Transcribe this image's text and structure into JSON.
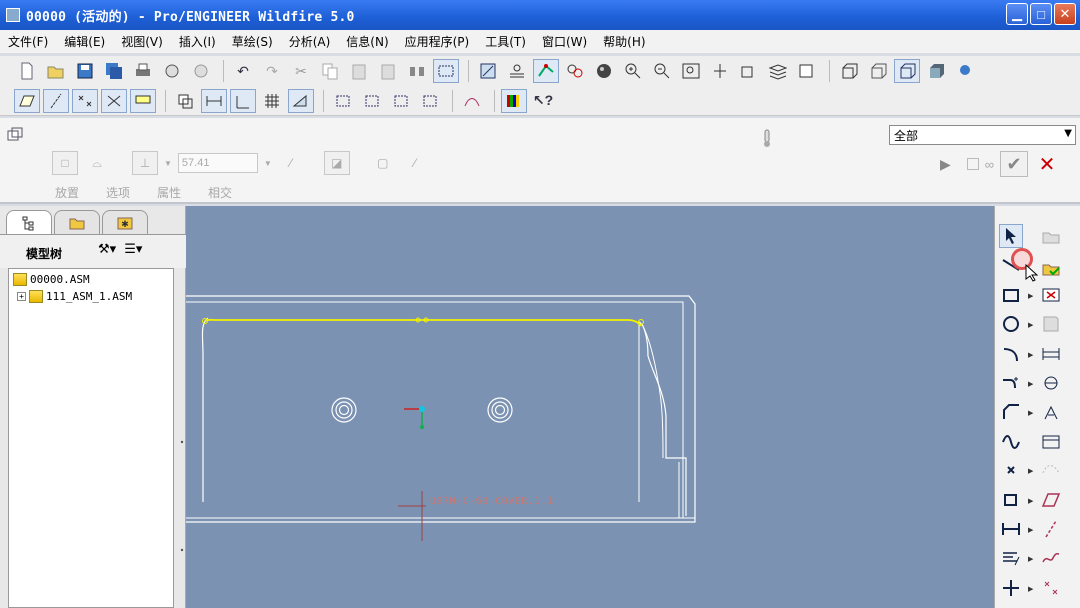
{
  "window": {
    "title": "00000 (活动的) - Pro/ENGINEER Wildfire 5.0"
  },
  "menu": [
    "文件(F)",
    "编辑(E)",
    "视图(V)",
    "插入(I)",
    "草绘(S)",
    "分析(A)",
    "信息(N)",
    "应用程序(P)",
    "工具(T)",
    "窗口(W)",
    "帮助(H)"
  ],
  "dashboard": {
    "filter_value": "全部",
    "value_field": "57.41",
    "tabs": [
      "放置",
      "选项",
      "属性",
      "相交"
    ]
  },
  "model_tree": {
    "title": "模型树",
    "items": [
      {
        "label": "00000.ASM"
      },
      {
        "label": "111_ASM_1.ASM"
      }
    ]
  },
  "canvas": {
    "annotation": "U97N-C-6B.COVER.1.1"
  },
  "colors": {
    "canvas_bg": "#7b92b2",
    "titlebar": "#1d5fd6",
    "highlight": "#f2f200",
    "edges": "#ffffff"
  }
}
